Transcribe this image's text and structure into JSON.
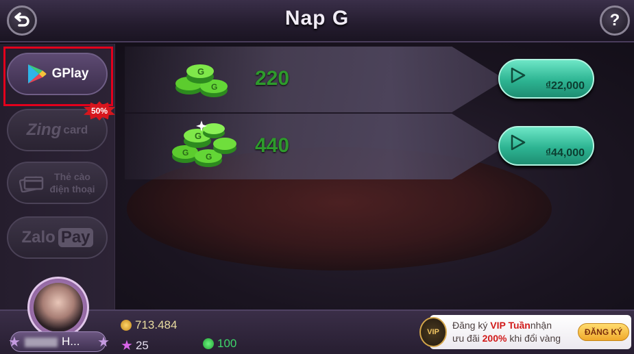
{
  "header": {
    "title": "Nap G",
    "back_icon": "back-arrow-icon",
    "help_label": "?"
  },
  "sidebar": {
    "items": [
      {
        "id": "gplay",
        "label": "GPlay",
        "active": true,
        "badge": "50%"
      },
      {
        "id": "zing",
        "label": "Zing",
        "sublabel": "card"
      },
      {
        "id": "card",
        "label_line1": "Thẻ cào",
        "label_line2": "điện thoại"
      },
      {
        "id": "zalo",
        "label": "Zalo",
        "sublabel": "Pay"
      }
    ]
  },
  "packages": [
    {
      "amount": "220",
      "price": "₫22,000"
    },
    {
      "amount": "440",
      "price": "₫44,000"
    }
  ],
  "footer": {
    "player_name": "H...",
    "gold": "713.484",
    "stars": "25",
    "gcoins": "100",
    "vip": {
      "emblem": "VIP",
      "line1_prefix": "Đăng ký ",
      "line1_highlight": "VIP Tuần",
      "line1_suffix": "nhận",
      "line2_prefix": "ưu đãi ",
      "line2_highlight": "200%",
      "line2_suffix": " khi đổi vàng",
      "button": "ĐĂNG KÝ"
    }
  },
  "colors": {
    "accent_green": "#2e9a2c",
    "buy_button": "#2db492",
    "highlight_box": "#e3001c"
  }
}
